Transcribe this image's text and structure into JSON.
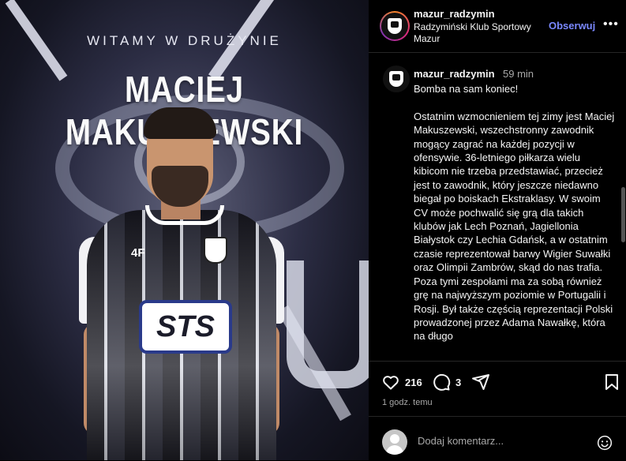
{
  "post": {
    "banner_text": "WITAMY W DRUŻYNIE",
    "player_name": "MACIEJ MAKUSZEWSKI",
    "kit_brand": "4F",
    "sponsor": "STS"
  },
  "header": {
    "username": "mazur_radzymin",
    "subtitle": "Radzymiński Klub Sportowy Mazur",
    "follow_label": "Obserwuj",
    "more_label": "•••"
  },
  "caption": {
    "username": "mazur_radzymin",
    "time": "59 min",
    "text": "Bomba na sam koniec!\n\nOstatnim wzmocnieniem tej zimy jest Maciej Makuszewski, wszechstronny zawodnik mogący zagrać na każdej pozycji w ofensywie. 36-letniego piłkarza wielu kibicom nie trzeba przedstawiać, przecież jest to zawodnik, który jeszcze niedawno biegał po boiskach Ekstraklasy. W swoim CV może pochwalić się grą dla takich klubów jak Lech Poznań, Jagiellonia Białystok czy Lechia Gdańsk, a w ostatnim czasie reprezentował barwy Wigier Suwałki oraz Olimpii Zambrów, skąd do nas trafia. Poza tymi zespołami ma za sobą również grę na najwyższym poziomie w Portugalii i Rosji. Był także częścią reprezentacji Polski prowadzonej przez Adama Nawałkę, która na długo"
  },
  "actions": {
    "likes": "216",
    "comments": "3",
    "timestamp": "1 godz. temu"
  },
  "comment_box": {
    "placeholder": "Dodaj komentarz..."
  },
  "colors": {
    "accent": "#7a88ff",
    "muted": "#a8a8a8",
    "divider": "#262626"
  }
}
